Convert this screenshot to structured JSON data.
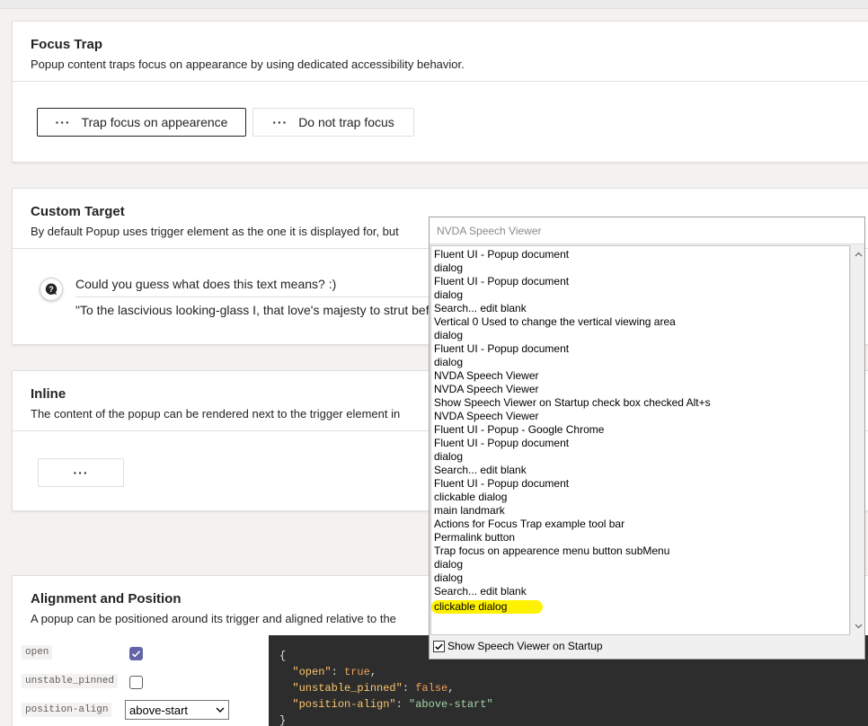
{
  "focus_trap": {
    "title": "Focus Trap",
    "description": "Popup content traps focus on appearance by using dedicated accessibility behavior.",
    "trap_button_label": "Trap focus on appearence",
    "no_trap_button_label": "Do not trap focus"
  },
  "custom_target": {
    "title": "Custom Target",
    "description": "By default Popup uses trigger element as the one it is displayed for, but",
    "guess_text": "Could you guess what does this text means? :)",
    "quote_text": "\"To the lascivious looking-glass I, that love's majesty to strut befo"
  },
  "inline": {
    "title": "Inline",
    "description": "The content of the popup can be rendered next to the trigger element in"
  },
  "alignment": {
    "title": "Alignment and Position",
    "description": "A popup can be positioned around its trigger and aligned relative to the",
    "knobs": [
      {
        "label": "open",
        "checked": true
      },
      {
        "label": "unstable_pinned",
        "checked": false
      },
      {
        "label": "position-align",
        "value": "above-start"
      }
    ],
    "code": {
      "open_brace": "{",
      "close_brace": "}",
      "line1_key": "\"open\"",
      "line1_val": "true",
      "line2_key": "\"unstable_pinned\"",
      "line2_val": "false",
      "line3_key": "\"position-align\"",
      "line3_val": "\"above-start\""
    }
  },
  "nvda": {
    "title": "NVDA Speech Viewer",
    "lines": [
      "Fluent UI - Popup  document",
      "dialog",
      "Fluent UI - Popup  document",
      "dialog",
      "Search...  edit  blank",
      "Vertical 0 Used to change the vertical viewing area",
      "dialog",
      "Fluent UI - Popup  document",
      "dialog",
      "NVDA Speech Viewer",
      "NVDA Speech Viewer",
      "Show Speech Viewer on Startup  check box  checked  Alt+s",
      "NVDA Speech Viewer",
      "Fluent UI - Popup - Google Chrome",
      "Fluent UI - Popup  document",
      "dialog",
      "Search...  edit  blank",
      "Fluent UI - Popup  document",
      "clickable  dialog",
      "main landmark",
      "Actions for Focus Trap example  tool bar",
      "Permalink  button",
      "Trap focus on appearence  menu button  subMenu",
      "dialog",
      "dialog",
      "Search...  edit  blank"
    ],
    "highlighted_line": "clickable  dialog",
    "startup_label": "Show Speech Viewer on Startup",
    "startup_checked": true
  },
  "colors": {
    "accent": "#6264a7",
    "highlight": "#fff200",
    "code_bg": "#2d2d2d"
  }
}
